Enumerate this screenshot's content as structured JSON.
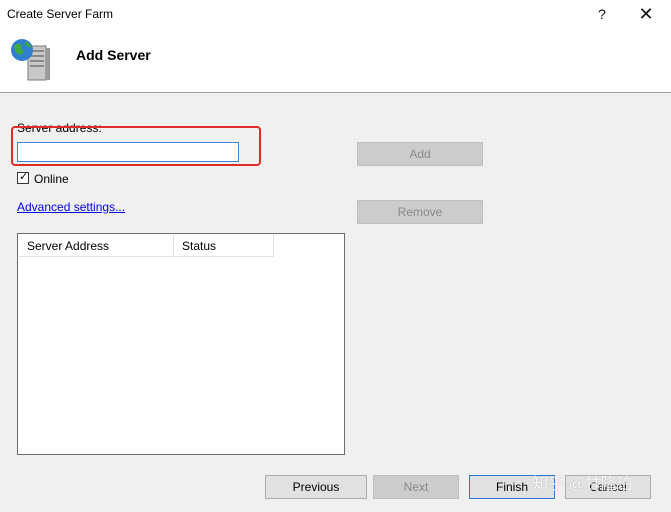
{
  "window": {
    "title": "Create Server Farm",
    "help_glyph": "?",
    "close_glyph": "✕"
  },
  "header": {
    "title": "Add Server",
    "icon": "server-globe-icon"
  },
  "form": {
    "server_address_label": "Server address:",
    "server_address_value": "",
    "online_label": "Online",
    "online_checked": true,
    "advanced_link": "Advanced settings..."
  },
  "buttons": {
    "add": "Add",
    "remove": "Remove",
    "previous": "Previous",
    "next": "Next",
    "finish": "Finish",
    "cancel": "Cancel"
  },
  "table": {
    "columns": [
      "Server Address",
      "Status"
    ],
    "rows": []
  },
  "watermark": "知乎 @甘隆珀",
  "colors": {
    "highlight": "#e02b2b",
    "link": "#0000ee",
    "focus_border": "#3a86d8"
  }
}
